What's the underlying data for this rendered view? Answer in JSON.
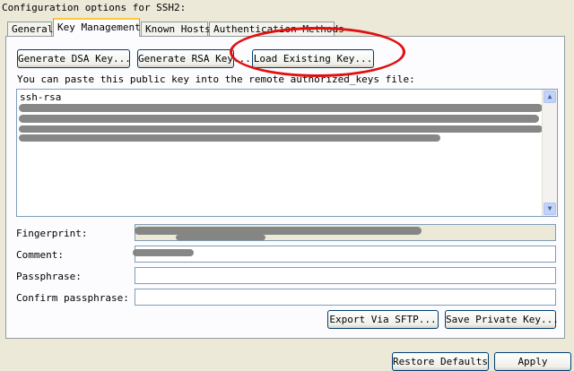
{
  "window": {
    "title": "Configuration options for SSH2:"
  },
  "tabs": [
    {
      "label": "General"
    },
    {
      "label": "Key Management"
    },
    {
      "label": "Known Hosts"
    },
    {
      "label": "Authentication Methods"
    }
  ],
  "key_management": {
    "generate_dsa_label": "Generate DSA Key...",
    "generate_rsa_label": "Generate RSA Key...",
    "load_existing_label": "Load Existing Key...",
    "paste_hint": "You can paste this public key into the remote authorized_keys file:",
    "public_key_prefix": "ssh-rsa",
    "fingerprint_label": "Fingerprint:",
    "comment_label": "Comment:",
    "passphrase_label": "Passphrase:",
    "confirm_passphrase_label": "Confirm passphrase:",
    "export_sftp_label": "Export Via SFTP...",
    "save_private_key_label": "Save Private Key..."
  },
  "footer": {
    "restore_defaults_label": "Restore Defaults",
    "apply_label": "Apply"
  },
  "colors": {
    "accent_highlight": "#e01010",
    "window_bg": "#ece9d8"
  }
}
